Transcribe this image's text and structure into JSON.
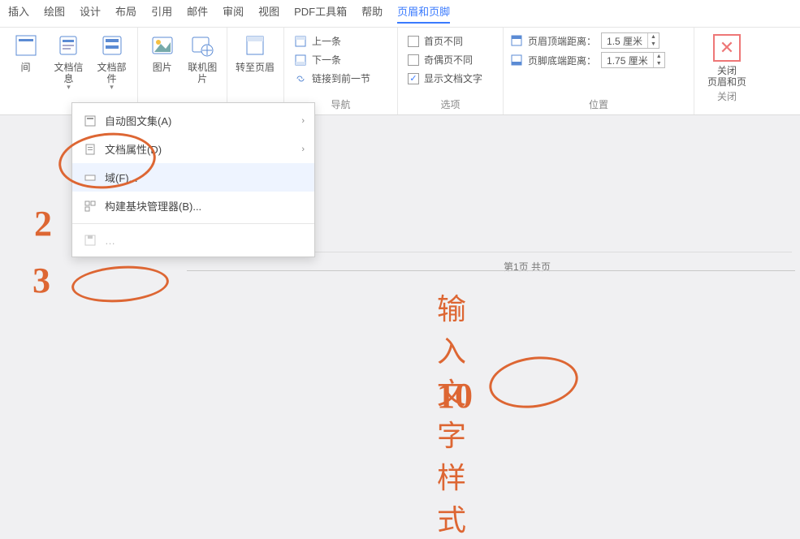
{
  "menubar": [
    "插入",
    "绘图",
    "设计",
    "布局",
    "引用",
    "邮件",
    "审阅",
    "视图",
    "PDF工具箱",
    "帮助",
    "页眉和页脚"
  ],
  "menubar_active": 10,
  "ribbon": {
    "g1": {
      "btn_time": "间",
      "btn_docinfo": "文档信息",
      "btn_parts": "文档部件"
    },
    "g2": {
      "btn_pic": "图片",
      "btn_onlinepic": "联机图片"
    },
    "g3": {
      "btn_goheader": "转至页眉"
    },
    "nav": {
      "prev": "上一条",
      "next": "下一条",
      "link": "链接到前一节",
      "label": "导航"
    },
    "opts": {
      "fp": "首页不同",
      "oe": "奇偶页不同",
      "showtext": "显示文档文字",
      "showtext_checked": true,
      "label": "选项"
    },
    "pos": {
      "htop": "页眉顶端距离：",
      "htop_val": "1.5 厘米",
      "fbot": "页脚底端距离：",
      "fbot_val": "1.75 厘米",
      "label": "位置"
    },
    "close": {
      "line1": "关闭",
      "line2": "页眉和页",
      "label": "关闭"
    }
  },
  "dropdown": {
    "autotext": "自动图文集(A)",
    "docprop": "文档属性(D)",
    "field": "域(F)...",
    "blocks": "构建基块管理器(B)..."
  },
  "annot": {
    "n2": "2",
    "n3": "3",
    "n10": "10",
    "handwrite": "输入文字样式"
  },
  "footer": {
    "text": "第1页 共页"
  }
}
